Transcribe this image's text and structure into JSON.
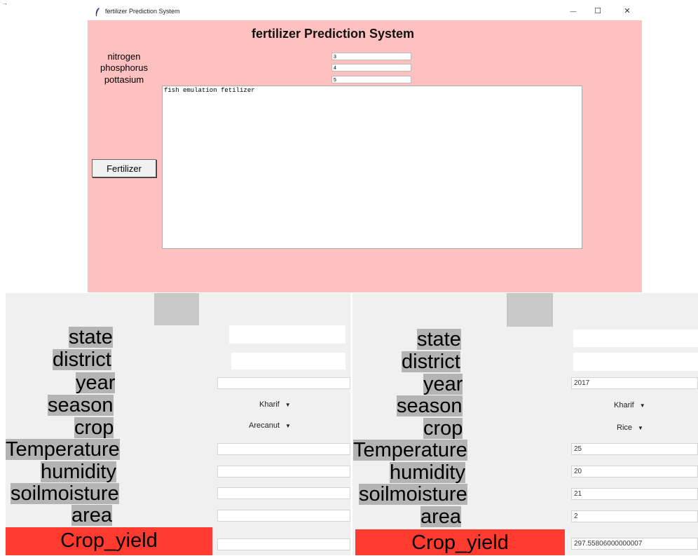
{
  "window": {
    "title": "fertilizer Prediction System",
    "controls": {
      "minimize": "—",
      "maximize": "☐",
      "close": "✕"
    }
  },
  "fertilizer": {
    "heading": "fertilizer Prediction System",
    "fields": [
      {
        "label": "nitrogen",
        "value": "3"
      },
      {
        "label": "phosphorus",
        "value": "4"
      },
      {
        "label": "pottasium",
        "value": "5"
      }
    ],
    "result_text": "fish emulation fetilizer",
    "button_label": "Fertilizer"
  },
  "left_panel": {
    "labels": {
      "state": "state",
      "district": "district",
      "year": "year",
      "season": "season",
      "crop": "crop",
      "temperature": "Temperature",
      "humidity": "humidity",
      "soilmoisture": "soilmoisture",
      "area": "area"
    },
    "values": {
      "state": "",
      "district": "",
      "year": "",
      "temperature": "",
      "humidity": "",
      "soilmoisture": "",
      "area": "",
      "result": ""
    },
    "season_selected": "Kharif",
    "crop_selected": "Arecanut",
    "button_label": "Crop_yield"
  },
  "right_panel": {
    "labels": {
      "state": "state",
      "district": "district",
      "year": "year",
      "season": "season",
      "crop": "crop",
      "temperature": "Temperature",
      "humidity": "humidity",
      "soilmoisture": "soilmoisture",
      "area": "area"
    },
    "values": {
      "state": "",
      "district": "",
      "year": "2017",
      "temperature": "25",
      "humidity": "20",
      "soilmoisture": "21",
      "area": "2",
      "result": "297.55806000000007"
    },
    "season_selected": "Kharif",
    "crop_selected": "Rice",
    "button_label": "Crop_yield"
  },
  "colors": {
    "window_bg": "#ffc0c0",
    "label_bg": "#b4b4b4",
    "button_red": "#ff3b30",
    "panel_bg": "#f0f0f0"
  }
}
